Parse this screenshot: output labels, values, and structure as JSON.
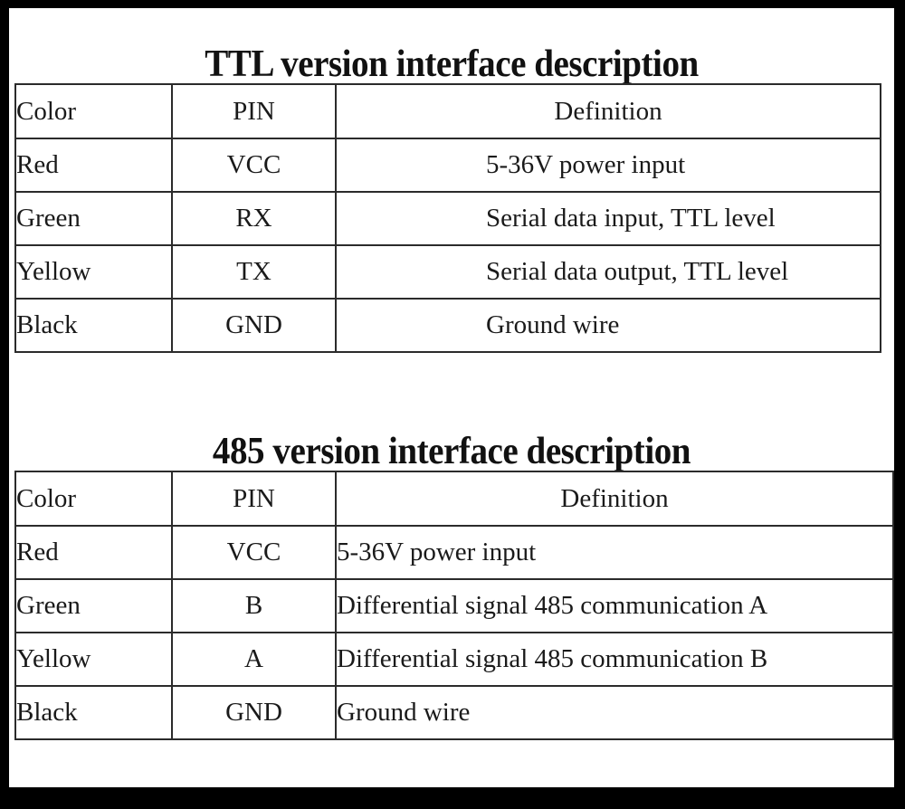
{
  "document": {
    "background_color": "#000000",
    "page_color": "#ffffff",
    "text_color": "#1a1a1a",
    "border_color": "#2b2b2b"
  },
  "sections": [
    {
      "id": "ttl",
      "title": "TTL version interface description",
      "table": {
        "columns": [
          "Color",
          "PIN",
          "Definition"
        ],
        "rows": [
          {
            "color": "Red",
            "pin": "VCC",
            "definition": "5-36V power input"
          },
          {
            "color": "Green",
            "pin": "RX",
            "definition": "Serial data input, TTL level"
          },
          {
            "color": "Yellow",
            "pin": "TX",
            "definition": "Serial data output, TTL level"
          },
          {
            "color": "Black",
            "pin": "GND",
            "definition": "Ground wire"
          }
        ]
      }
    },
    {
      "id": "485",
      "title": "485 version interface description",
      "table": {
        "columns": [
          "Color",
          "PIN",
          "Definition"
        ],
        "rows": [
          {
            "color": "Red",
            "pin": "VCC",
            "definition": "5-36V power input"
          },
          {
            "color": "Green",
            "pin": "B",
            "definition": "Differential signal 485 communication A"
          },
          {
            "color": "Yellow",
            "pin": "A",
            "definition": "Differential signal 485 communication B"
          },
          {
            "color": "Black",
            "pin": "GND",
            "definition": "Ground wire"
          }
        ]
      }
    }
  ]
}
